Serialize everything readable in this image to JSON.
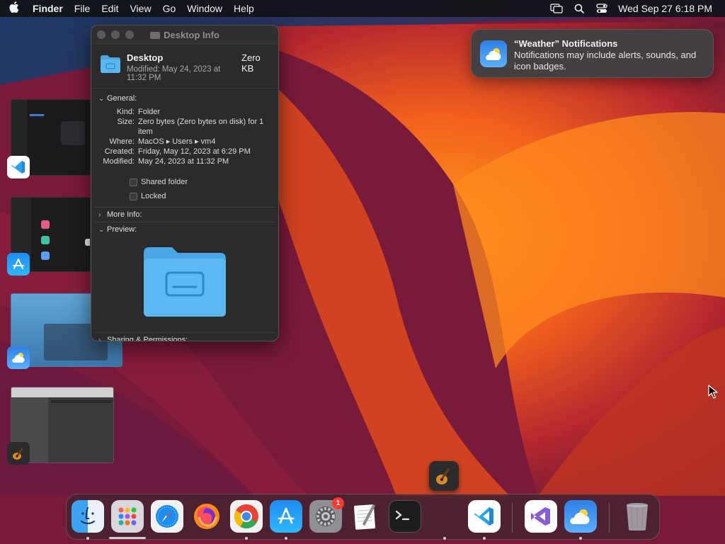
{
  "menubar": {
    "apple": "",
    "app": "Finder",
    "items": [
      "File",
      "Edit",
      "View",
      "Go",
      "Window",
      "Help"
    ],
    "clock": "Wed Sep 27  6:18 PM",
    "status_icons": [
      "screen-mirroring-icon",
      "search-icon",
      "control-center-icon"
    ]
  },
  "info_window": {
    "title": "Desktop Info",
    "name": "Desktop",
    "size": "Zero KB",
    "modified_header": "Modified: May 24, 2023 at 11:32 PM",
    "general": {
      "heading": "General:",
      "rows": [
        {
          "k": "Kind:",
          "v": "Folder"
        },
        {
          "k": "Size:",
          "v": "Zero bytes (Zero bytes on disk) for 1 item"
        },
        {
          "k": "Where:",
          "v": "MacOS ▸ Users ▸ vm4"
        },
        {
          "k": "Created:",
          "v": "Friday, May 12, 2023 at 6:29 PM"
        },
        {
          "k": "Modified:",
          "v": "May 24, 2023 at 11:32 PM"
        }
      ],
      "shared_folder": "Shared folder",
      "locked": "Locked"
    },
    "more_info": "More Info:",
    "preview": "Preview:",
    "sharing": "Sharing & Permissions:"
  },
  "notification": {
    "title": "“Weather” Notifications",
    "body": "Notifications may include alerts, sounds, and icon badges."
  },
  "dock": {
    "items": [
      "Finder",
      "Launchpad",
      "Safari",
      "Firefox",
      "Google Chrome",
      "App Store",
      "System Settings",
      "TextEdit",
      "Terminal",
      "Visual Studio Code",
      "Visual Studio",
      "Weather",
      "Trash"
    ],
    "settings_badge": "1"
  },
  "colors": {
    "accent": "#2f7fe6",
    "folder": "#5ab8f0",
    "badge": "#ff3b30"
  }
}
